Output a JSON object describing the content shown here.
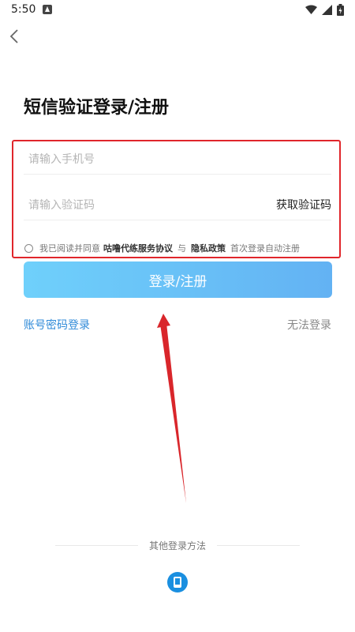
{
  "status_bar": {
    "time": "5:50"
  },
  "page": {
    "title": "短信验证登录/注册"
  },
  "form": {
    "phone_placeholder": "请输入手机号",
    "code_placeholder": "请输入验证码",
    "get_code_label": "获取验证码"
  },
  "agreement": {
    "prefix": "我已阅读并同意",
    "service_link": "咕噜代练服务协议",
    "connector": "与",
    "privacy_link": "隐私政策",
    "suffix": "首次登录自动注册"
  },
  "login_button": {
    "label": "登录/注册"
  },
  "links": {
    "account_login": "账号密码登录",
    "cannot_login": "无法登录"
  },
  "other_login": {
    "label": "其他登录方法"
  },
  "colors": {
    "accent_blue": "#2f8ad8",
    "highlight_red": "#e0262b",
    "button_gradient_start": "#6fd0fb",
    "button_gradient_end": "#63b2f3"
  },
  "icons": [
    "back-arrow-icon",
    "notification-icon",
    "wifi-icon",
    "signal-icon",
    "battery-icon",
    "phone-icon"
  ]
}
